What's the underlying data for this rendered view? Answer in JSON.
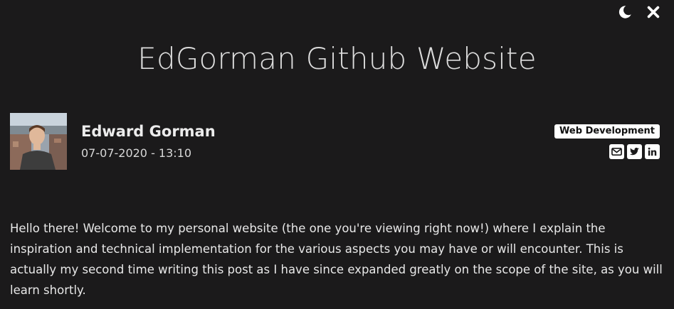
{
  "controls": {
    "theme_icon": "moon-icon",
    "close_icon": "close-icon"
  },
  "post": {
    "title": "EdGorman Github Website",
    "author_name": "Edward Gorman",
    "date": "07-07-2020 - 13:10",
    "tag": "Web Development",
    "social_icons": [
      "email-icon",
      "twitter-icon",
      "linkedin-icon"
    ],
    "intro": "Hello there! Welcome to my personal website (the one you're viewing right now!) where I explain the inspiration and technical implementation for the various aspects you may have or will encounter. This is actually my second time writing this post as I have since expanded greatly on the scope of the site, as you will learn shortly."
  },
  "colors": {
    "background": "#1b1a1b",
    "text": "#e6e6e6",
    "tag_background": "#ffffff",
    "tag_text": "#111111"
  }
}
